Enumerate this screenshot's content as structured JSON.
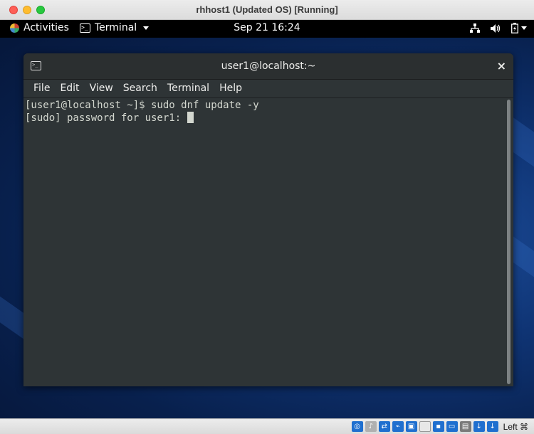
{
  "host_window": {
    "title": "rhhost1 (Updated OS) [Running]"
  },
  "topbar": {
    "activities_label": "Activities",
    "app_menu_label": "Terminal",
    "clock": "Sep 21  16:24",
    "tray_icons": [
      "network-icon",
      "volume-icon",
      "battery-icon"
    ]
  },
  "terminal_window": {
    "title": "user1@localhost:~",
    "close_label": "×",
    "menu": [
      "File",
      "Edit",
      "View",
      "Search",
      "Terminal",
      "Help"
    ],
    "lines": [
      "[user1@localhost ~]$ sudo dnf update -y",
      "[sudo] password for user1: "
    ]
  },
  "vbox_statusbar": {
    "host_key_label": "Left ⌘",
    "icons": [
      "optical-drive-icon",
      "audio-icon",
      "network-adapter-icon",
      "usb-icon",
      "shared-folder-icon",
      "display-icon",
      "video-capture-icon",
      "recording-icon",
      "cpu-icon",
      "mouse-integration-icon",
      "keyboard-capture-icon"
    ],
    "colors": {
      "primary": "#1f6fcf",
      "secondary": "#7a7a7a"
    }
  },
  "colors": {
    "terminal_bg": "#2e3436",
    "terminal_fg": "#d3d7cf",
    "topbar_bg": "#000000",
    "desktop_bg": "#0f3474"
  }
}
